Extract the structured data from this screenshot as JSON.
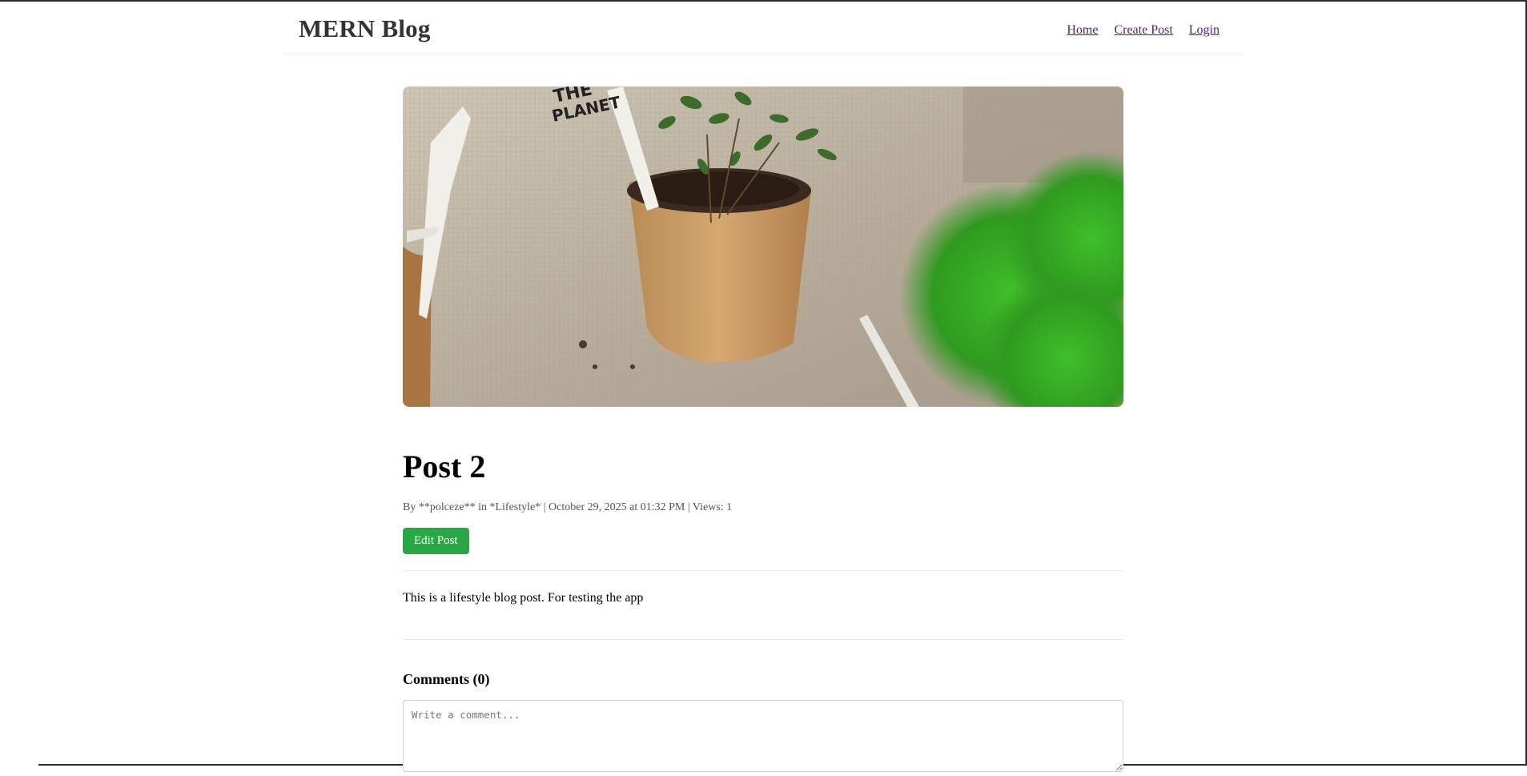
{
  "header": {
    "brand": "MERN Blog",
    "nav": [
      "Home",
      "Create Post",
      "Login"
    ]
  },
  "hero": {
    "label_line1": "THE",
    "label_line2": "PLANET"
  },
  "post": {
    "title": "Post 2",
    "meta": "By **polceze** in *Lifestyle* | October 29, 2025 at 01:32 PM | Views: 1",
    "edit_label": "Edit Post",
    "content": "This is a lifestyle blog post. For testing the app"
  },
  "comments": {
    "title": "Comments (0)",
    "placeholder": "Write a comment..."
  },
  "colors": {
    "accent_green": "#28a745",
    "link_visited": "#551a8b"
  }
}
